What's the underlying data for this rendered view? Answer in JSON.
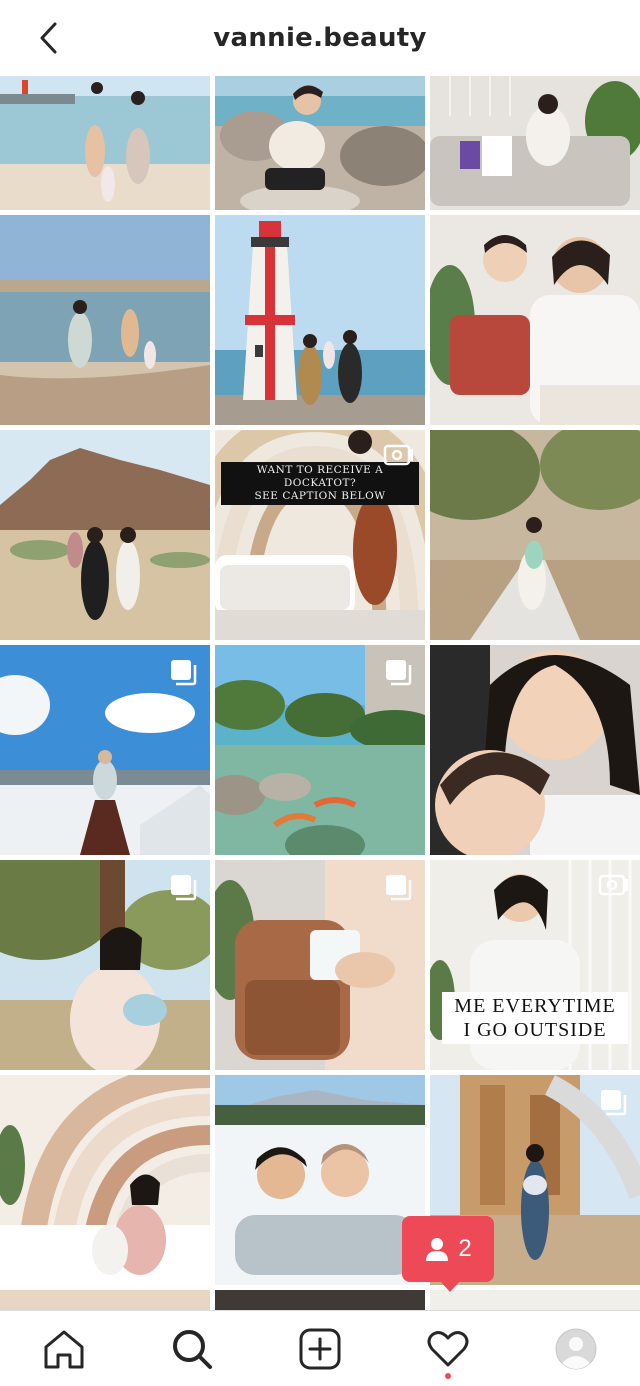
{
  "header": {
    "username": "vannie.beauty",
    "back_icon": "chevron-left-icon"
  },
  "grid": {
    "posts": [
      {
        "id": "beach-family",
        "icon": "",
        "scene": "beach"
      },
      {
        "id": "rock-girl",
        "icon": "",
        "scene": "rocks"
      },
      {
        "id": "sofa-mom",
        "icon": "",
        "scene": "sofa"
      },
      {
        "id": "lake-shore",
        "icon": "",
        "scene": "lake"
      },
      {
        "id": "lighthouse",
        "icon": "",
        "scene": "lighthouse"
      },
      {
        "id": "mom-kiss",
        "icon": "",
        "scene": "kiss"
      },
      {
        "id": "desert-family",
        "icon": "",
        "scene": "desert"
      },
      {
        "id": "dockatot",
        "icon": "video-camera-icon",
        "scene": "nursery"
      },
      {
        "id": "park-walk",
        "icon": "",
        "scene": "park"
      },
      {
        "id": "snow-skirt",
        "icon": "multiple-photos-icon",
        "scene": "snow"
      },
      {
        "id": "koi-pond",
        "icon": "multiple-photos-icon",
        "scene": "pond"
      },
      {
        "id": "selfie-baby",
        "icon": "",
        "scene": "selfie"
      },
      {
        "id": "tree-bag",
        "icon": "multiple-photos-icon",
        "scene": "tree"
      },
      {
        "id": "backpack",
        "icon": "multiple-photos-icon",
        "scene": "backpack"
      },
      {
        "id": "outside-meme",
        "icon": "video-camera-icon",
        "scene": "meme"
      },
      {
        "id": "rainbow-bed",
        "icon": "",
        "scene": "rainbow"
      },
      {
        "id": "snow-couple",
        "icon": "",
        "scene": "snowcouple"
      },
      {
        "id": "playground",
        "icon": "multiple-photos-icon",
        "scene": "playground"
      }
    ],
    "overlay_texts": {
      "dockatot_caption_line1": "WANT TO RECEIVE A DOCKATOT?",
      "dockatot_caption_line2": "SEE CAPTION BELOW",
      "meme_line1": "ME EVERYTIME",
      "meme_line2": "I GO OUTSIDE"
    }
  },
  "notification": {
    "icon": "person-icon",
    "count": "2",
    "color": "#ed4956"
  },
  "tabbar": {
    "items": [
      {
        "name": "home",
        "icon": "home-icon"
      },
      {
        "name": "search",
        "icon": "search-icon",
        "active": true
      },
      {
        "name": "new-post",
        "icon": "plus-square-icon"
      },
      {
        "name": "activity",
        "icon": "heart-icon",
        "has_dot": true
      },
      {
        "name": "profile",
        "icon": "avatar-icon"
      }
    ]
  }
}
